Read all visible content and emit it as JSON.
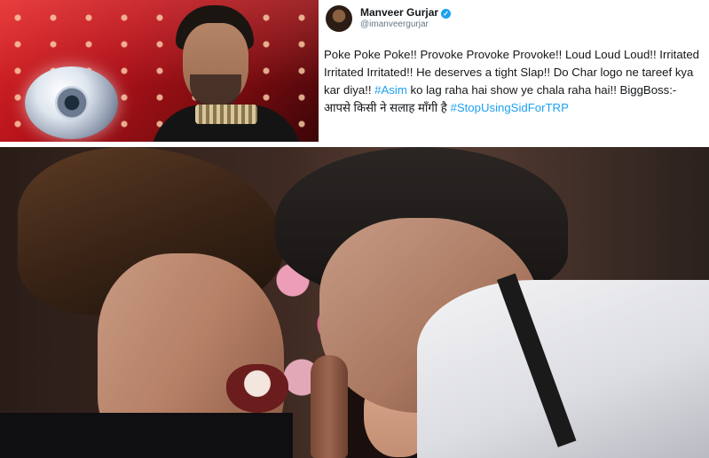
{
  "tweet": {
    "name": "Manveer Gurjar",
    "handle": "@imanveergurjar",
    "text_1": "Poke Poke Poke!! Provoke Provoke Provoke!! Loud Loud Loud!! Irritated Irritated Irritated!! He deserves a tight Slap!! Do Char logo ne tareef kya kar diya!! ",
    "hashtag_asim": "#Asim",
    "text_2": " ko lag raha hai show ye chala raha hai!! BiggBoss:- आपसे किसी ने सलाह माँगी है ",
    "hashtag_trp": "#StopUsingSidForTRP",
    "verified_symbol": "✓"
  },
  "colors": {
    "hashtag": "#1da1f2",
    "name": "#14171a",
    "handle": "#657786"
  }
}
